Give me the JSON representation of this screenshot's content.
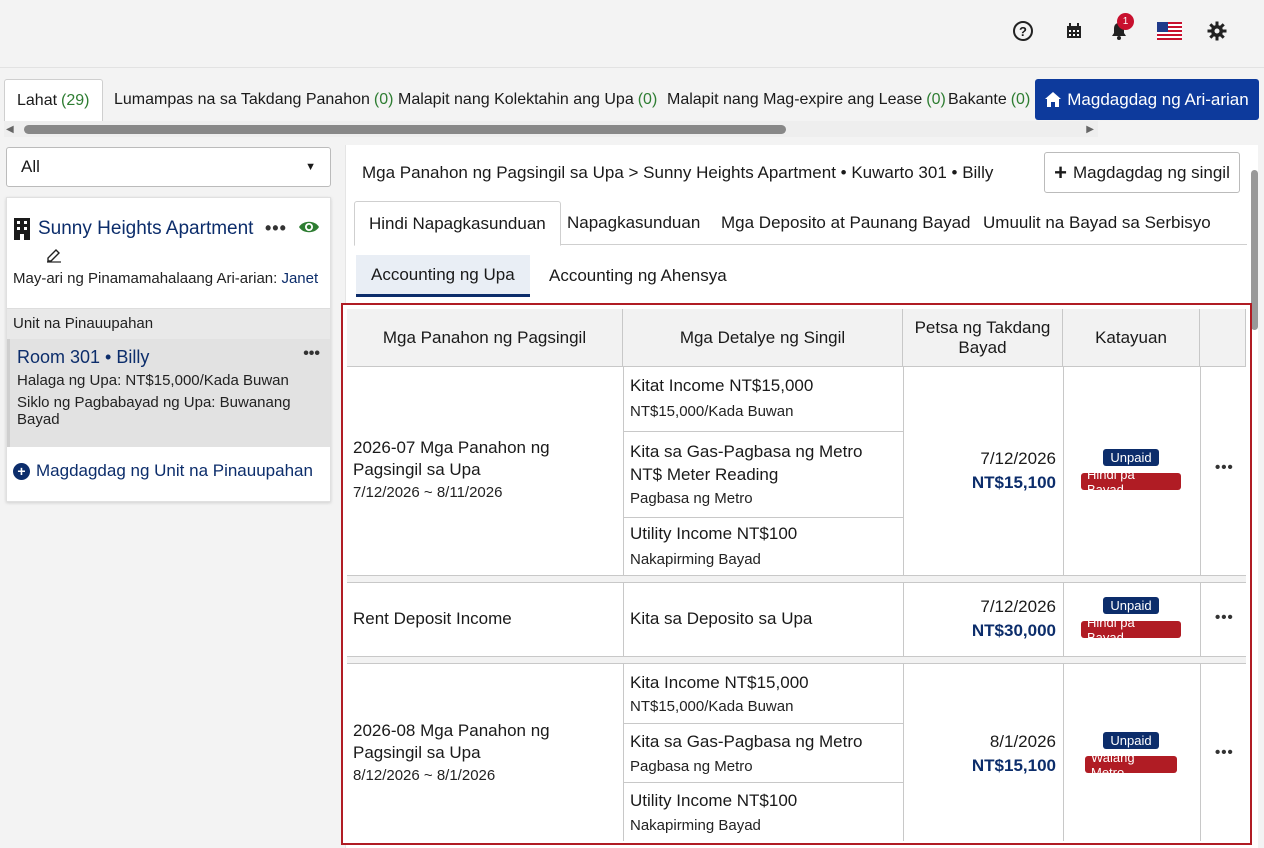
{
  "topbar": {
    "help_icon": "help-icon",
    "calendar_icon": "calendar-icon",
    "bell_icon": "bell-icon",
    "notification_count": "1",
    "flag_icon": "us-flag-icon",
    "gear_icon": "gear-icon"
  },
  "property_tabs": [
    {
      "label": "Lahat",
      "count": "(29)"
    },
    {
      "label": "Lumampas na sa Takdang Panahon",
      "count": "(0)"
    },
    {
      "label": "Malapit nang Kolektahin ang Upa",
      "count": "(0)"
    },
    {
      "label": "Malapit nang Mag-expire ang Lease",
      "count": "(0)"
    },
    {
      "label": "Bakante",
      "count": "(0)"
    }
  ],
  "add_property_label": "Magdagdag ng Ari-arian",
  "filter": {
    "value": "All"
  },
  "property": {
    "name": "Sunny Heights Apartment",
    "owner_label": "May-ari ng Pinamamahalaang Ari-arian: ",
    "owner_name": "Janet",
    "units_header": "Unit na Pinauupahan",
    "unit": {
      "name": "Room 301 • Billy",
      "rent": "Halaga ng Upa: NT$15,000/Kada Buwan",
      "cycle": "Siklo ng Pagbabayad ng Upa: Buwanang Bayad"
    },
    "add_unit_label": "Magdagdag ng Unit na Pinauupahan"
  },
  "main": {
    "breadcrumb": "Mga Panahon ng Pagsingil sa Upa > Sunny Heights Apartment • Kuwarto 301 • Billy",
    "add_charge_label": "Magdagdag ng singil",
    "tabs": [
      "Hindi Napagkasunduan",
      "Napagkasunduan",
      "Mga Deposito at Paunang Bayad",
      "Umuulit na Bayad sa Serbisyo"
    ],
    "subtabs": [
      "Accounting ng Upa",
      "Accounting ng Ahensya"
    ]
  },
  "table": {
    "headers": [
      "Mga Panahon ng Pagsingil",
      "Mga Detalye ng Singil",
      "Petsa ng Takdang Bayad",
      "Katayuan"
    ],
    "groups": [
      {
        "period_title": "2026-07 Mga Panahon ng Pagsingil sa Upa",
        "period_range": "7/12/2026 ~ 8/11/2026",
        "details": [
          {
            "title": "Kitat Income NT$15,000",
            "sub": "NT$15,000/Kada Buwan"
          },
          {
            "title": "Kita sa Gas-Pagbasa ng Metro NT$ Meter Reading",
            "sub": "Pagbasa ng Metro"
          },
          {
            "title": "Utility Income NT$100",
            "sub": "Nakapirming Bayad"
          }
        ],
        "due_date": "7/12/2026",
        "amount": "NT$15,100",
        "status1": "Unpaid",
        "status2": "Hindi pa Bayad"
      },
      {
        "period_title": "Rent Deposit Income",
        "details": [
          {
            "title": "Kita sa Deposito sa Upa"
          }
        ],
        "due_date": "7/12/2026",
        "amount": "NT$30,000",
        "status1": "Unpaid",
        "status2": "Hindi pa Bayad"
      },
      {
        "period_title": "2026-08 Mga Panahon ng Pagsingil sa Upa",
        "period_range": "8/12/2026 ~ 8/1/2026",
        "details": [
          {
            "title": "Kita Income NT$15,000",
            "sub": "NT$15,000/Kada Buwan"
          },
          {
            "title": "Kita sa Gas-Pagbasa ng Metro",
            "sub": "Pagbasa ng Metro"
          },
          {
            "title": "Utility Income NT$100",
            "sub": "Nakapirming Bayad"
          }
        ],
        "due_date": "8/1/2026",
        "amount": "NT$15,100",
        "status1": "Unpaid",
        "status2": "Walang Metro"
      }
    ]
  },
  "colors": {
    "brand": "#0d3a9c",
    "navy": "#0c2d6b",
    "alert": "#b01c24",
    "count_green": "#2e7d32"
  }
}
